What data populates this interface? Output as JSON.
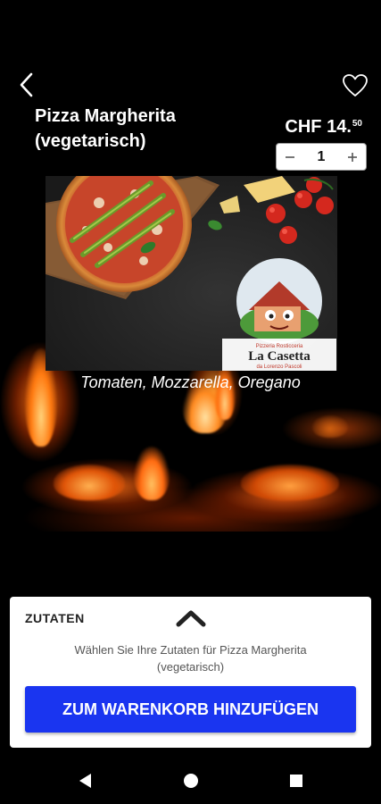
{
  "product": {
    "title": "Pizza Margherita (vegetarisch)",
    "currency_price": "CHF 14.",
    "price_cents": "50",
    "quantity": "1",
    "description": "Tomaten, Mozzarella, Oregano"
  },
  "image": {
    "logo_small_top": "Pizzeria Rosticceria",
    "logo_brand": "La Casetta",
    "logo_sub": "da Lorenzo Pascoli"
  },
  "panel": {
    "section_label": "ZUTATEN",
    "hint": "Wählen Sie Ihre Zutaten für Pizza Margherita (vegetarisch)",
    "add_to_cart": "ZUM WARENKORB HINZUFÜGEN"
  },
  "icons": {
    "back": "back-arrow-icon",
    "favorite": "heart-icon",
    "decrement": "minus-icon",
    "increment": "plus-icon",
    "expand": "chevron-up-icon",
    "nav_back": "triangle-back-icon",
    "nav_home": "circle-home-icon",
    "nav_recents": "square-recents-icon"
  },
  "colors": {
    "background": "#000000",
    "primary_button": "#1a35f0",
    "panel": "#ffffff"
  }
}
